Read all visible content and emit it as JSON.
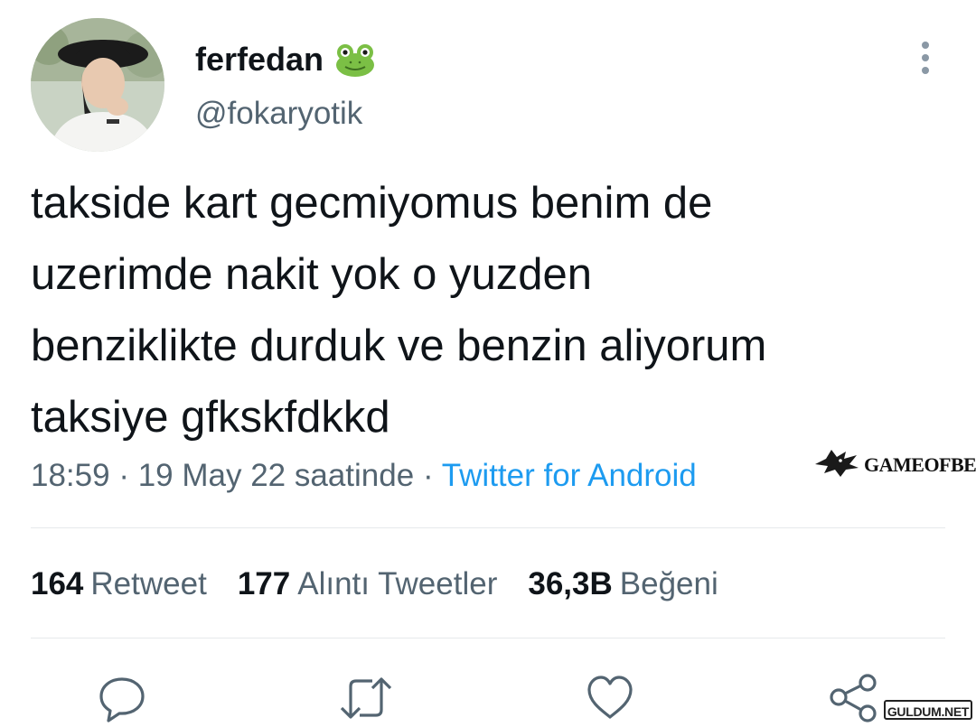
{
  "tweet": {
    "display_name": "ferfedan",
    "handle": "@fokaryotik",
    "name_emoji": "frog-icon",
    "text": "takside kart gecmiyomus benim de\nuzerimde nakit yok o yuzden\nbenziklikte durduk ve benzin aliyorum\ntaksiye gfkskfdkkd",
    "time": "18:59",
    "date": "19 May 22 saatinde",
    "separator": "·",
    "source": "Twitter for Android"
  },
  "stats": [
    {
      "count": "164",
      "label": "Retweet"
    },
    {
      "count": "177",
      "label": "Alıntı Tweetler"
    },
    {
      "count": "36,3B",
      "label": "Beğeni"
    }
  ],
  "actions": [
    "reply-icon",
    "retweet-icon",
    "like-icon",
    "share-icon"
  ],
  "watermarks": {
    "gameofbet": "GAMEOFBET",
    "gulum": "GULDUM.NET"
  },
  "colors": {
    "text": "#0f1419",
    "secondary": "#536471",
    "link": "#1d9bf0",
    "divider": "#e6e9eb"
  }
}
